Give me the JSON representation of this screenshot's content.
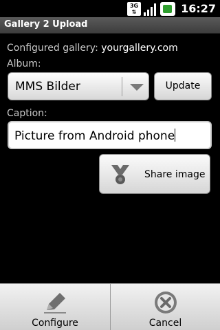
{
  "status_bar": {
    "network": "3G",
    "time": "16:27"
  },
  "app": {
    "title": "Gallery 2 Upload"
  },
  "gallery": {
    "label": "Configured gallery:",
    "value": "yourgallery.com"
  },
  "album": {
    "label": "Album:",
    "selected": "MMS Bilder",
    "update_label": "Update"
  },
  "caption": {
    "label": "Caption:",
    "value": "Picture from Android phone"
  },
  "share": {
    "label": "Share image"
  },
  "menu": {
    "configure_label": "Configure",
    "cancel_label": "Cancel"
  },
  "colors": {
    "battery": "#2e9e2e",
    "title_bar": "#4a4a4a",
    "background": "#000000"
  }
}
